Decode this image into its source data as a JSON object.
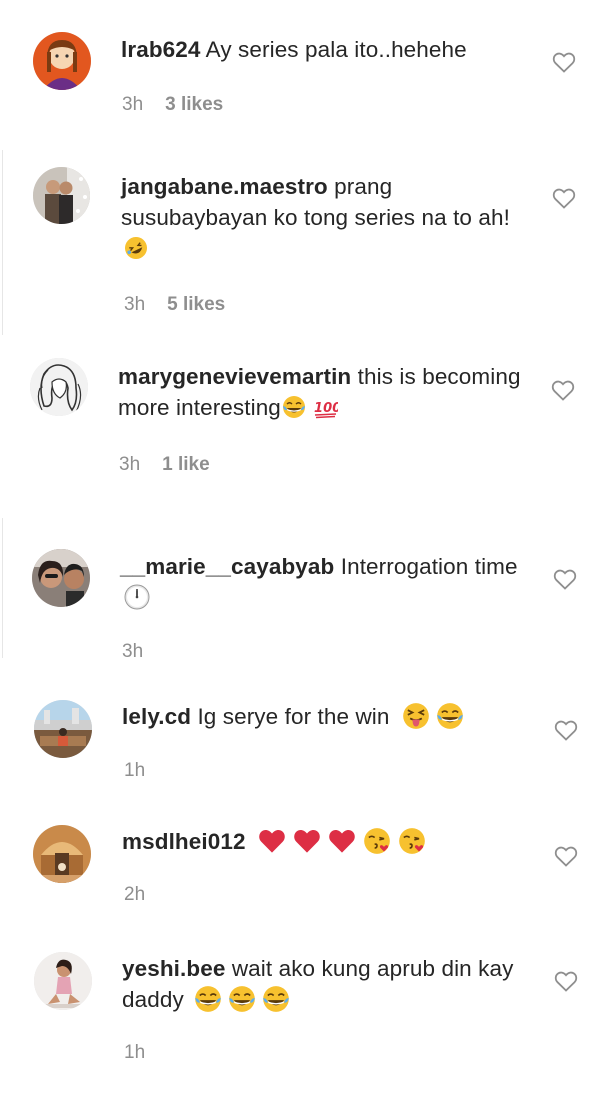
{
  "comments": [
    {
      "username": "lrab624",
      "text": "Ay series pala ito..hehehe",
      "time": "3h",
      "likes": "3 likes",
      "emojis": []
    },
    {
      "username": "jangabane.maestro",
      "text": "prang susubaybayan ko tong series na to ah!",
      "time": "3h",
      "likes": "5 likes",
      "emojis": [
        "rofl-emoji"
      ]
    },
    {
      "username": "marygenevievemartin",
      "text": "this is becoming more interesting",
      "time": "3h",
      "likes": "1 like",
      "emojis": [
        "tears-of-joy-emoji",
        "hundred-points-emoji"
      ]
    },
    {
      "username": "__marie__cayabyab",
      "text": "Interrogation time",
      "time": "3h",
      "likes": "",
      "emojis": [
        "clock-emoji"
      ]
    },
    {
      "username": "lely.cd",
      "text": "Ig serye for the win",
      "time": "1h",
      "likes": "",
      "emojis": [
        "squinting-tongue-emoji",
        "tears-of-joy-emoji"
      ]
    },
    {
      "username": "msdlhei012",
      "text": "",
      "time": "2h",
      "likes": "",
      "emojis": [
        "red-heart-emoji",
        "red-heart-emoji",
        "red-heart-emoji",
        "kissing-heart-emoji",
        "kissing-heart-emoji"
      ]
    },
    {
      "username": "yeshi.bee",
      "text": "wait ako kung aprub din kay daddy",
      "time": "1h",
      "likes": "",
      "emojis": [
        "tears-of-joy-emoji",
        "tears-of-joy-emoji",
        "tears-of-joy-emoji"
      ]
    }
  ],
  "icons": {
    "like": "heart-outline-icon"
  },
  "colors": {
    "text": "#262626",
    "muted": "#8e8e8e",
    "heart_stroke": "#8e8e8e",
    "emoji_yellow": "#f7c12f",
    "emoji_red": "#dd2e44"
  }
}
